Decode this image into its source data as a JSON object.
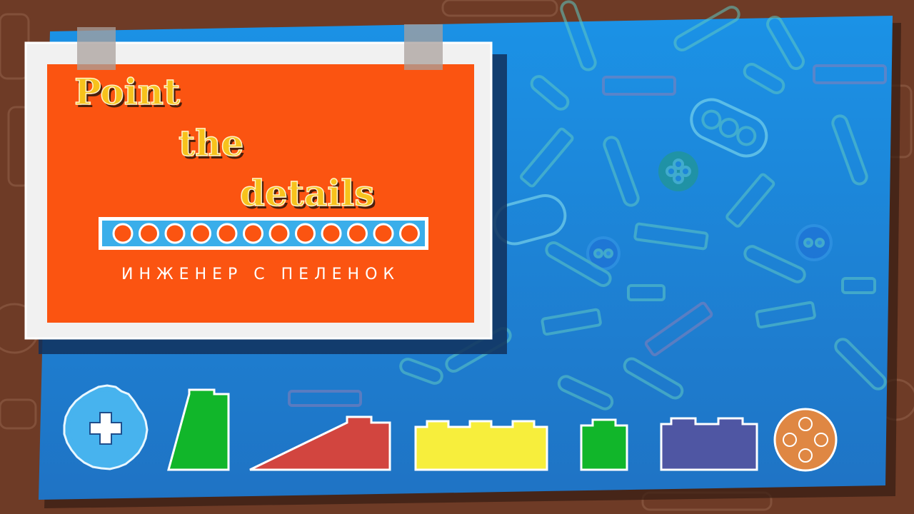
{
  "game": {
    "title_line1": "Point",
    "title_line2": "the",
    "title_line3": "details",
    "subtitle": "ИНЖЕНЕР С ПЕЛЕНОК"
  },
  "progress": {
    "total_slots": 12,
    "filled": 0
  },
  "palette": {
    "background_brown": "#6e3b26",
    "board_blue": "#1f86d6",
    "card_orange": "#fb5411",
    "card_border": "#f1f1f1",
    "title_yellow": "#f7c21c",
    "progress_blue": "#3aaeea"
  },
  "pieces": [
    {
      "name": "gear",
      "color": "#47b3ee",
      "icon": "gear-icon"
    },
    {
      "name": "slope-block",
      "color": "#11b62a",
      "icon": "slope-icon"
    },
    {
      "name": "ramp-block",
      "color": "#d2453f",
      "icon": "ramp-icon"
    },
    {
      "name": "brick-yellow",
      "color": "#f7ee3c",
      "icon": "brick-icon"
    },
    {
      "name": "brick-small-green",
      "color": "#11b62a",
      "icon": "brick-icon"
    },
    {
      "name": "brick-purple",
      "color": "#4f56a3",
      "icon": "brick-icon"
    },
    {
      "name": "round-plate",
      "color": "#df8743",
      "icon": "round-plate-icon"
    }
  ]
}
